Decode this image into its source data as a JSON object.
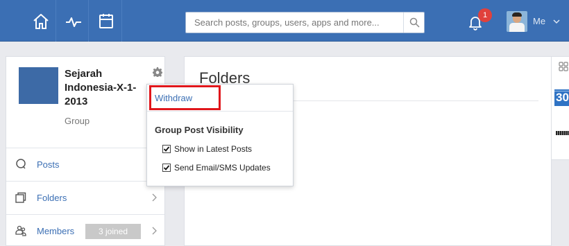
{
  "topbar": {
    "nav_icons": [
      "home-icon",
      "activity-icon",
      "calendar-icon"
    ],
    "search_placeholder": "Search posts, groups, users, apps and more...",
    "notification_count": "1",
    "user_label": "Me"
  },
  "group": {
    "name": "Sejarah Indonesia-X-1-2013",
    "type": "Group"
  },
  "menu": [
    {
      "label": "Posts",
      "icon": "chat-bubble-icon"
    },
    {
      "label": "Folders",
      "icon": "folder-stack-icon"
    },
    {
      "label": "Members",
      "icon": "people-icon",
      "badge": "3 joined"
    }
  ],
  "main": {
    "title": "Folders"
  },
  "right_panel": {
    "tile_number": "30"
  },
  "popup": {
    "withdraw_label": "Withdraw",
    "section_title": "Group Post Visibility",
    "options": [
      {
        "label": "Show in Latest Posts",
        "checked": true
      },
      {
        "label": "Send Email/SMS Updates",
        "checked": true
      }
    ]
  },
  "colors": {
    "topbar": "#3b6fb4",
    "link": "#3b6fb4",
    "badge": "#e0413c",
    "highlight": "#e0161b"
  }
}
